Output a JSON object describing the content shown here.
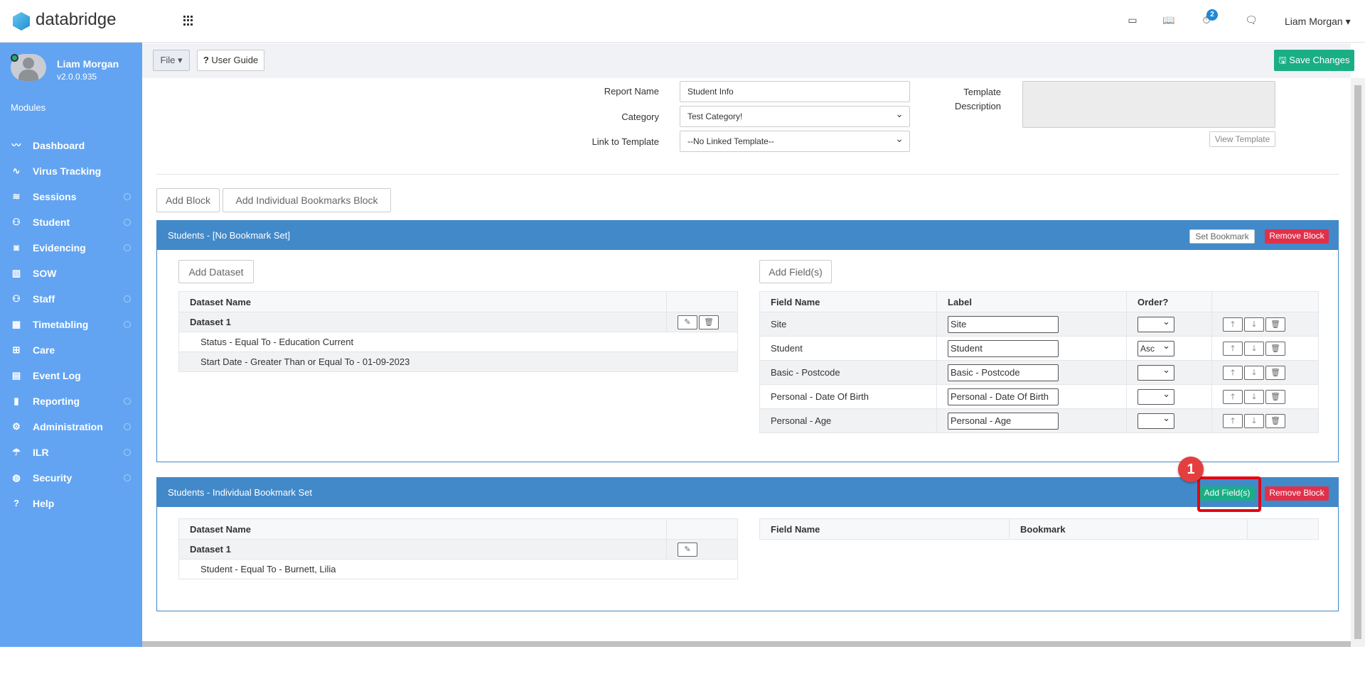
{
  "header": {
    "brand": "databridge",
    "notification_count": "2",
    "user": "Liam Morgan"
  },
  "sidebar": {
    "user_name": "Liam Morgan",
    "version": "v2.0.0.935",
    "modules_label": "Modules",
    "items": [
      {
        "label": "Dashboard",
        "icon": "chart-line-icon"
      },
      {
        "label": "Virus Tracking",
        "icon": "pulse-icon"
      },
      {
        "label": "Sessions",
        "icon": "layers-icon"
      },
      {
        "label": "Student",
        "icon": "users-icon"
      },
      {
        "label": "Evidencing",
        "icon": "camera-icon"
      },
      {
        "label": "SOW",
        "icon": "book-icon"
      },
      {
        "label": "Staff",
        "icon": "users-icon"
      },
      {
        "label": "Timetabling",
        "icon": "calendar-icon"
      },
      {
        "label": "Care",
        "icon": "care-icon"
      },
      {
        "label": "Event Log",
        "icon": "clipboard-icon"
      },
      {
        "label": "Reporting",
        "icon": "bar-chart-icon"
      },
      {
        "label": "Administration",
        "icon": "gear-icon"
      },
      {
        "label": "ILR",
        "icon": "umbrella-icon"
      },
      {
        "label": "Security",
        "icon": "globe-icon"
      },
      {
        "label": "Help",
        "icon": "help-icon"
      }
    ]
  },
  "toolbar": {
    "file": "File ▾",
    "user_guide": "User Guide",
    "save": "Save Changes"
  },
  "form": {
    "report_name_label": "Report Name",
    "report_name": "Student Info",
    "category_label": "Category",
    "category": "Test Category!",
    "link_label": "Link to Template",
    "link": "--No Linked Template--",
    "template_desc_label_1": "Template",
    "template_desc_label_2": "Description",
    "view_template": "View Template"
  },
  "actions": {
    "add_block": "Add Block",
    "add_bookmarks_block": "Add Individual Bookmarks Block"
  },
  "block1": {
    "title": "Students - [No Bookmark Set]",
    "set_bookmark": "Set Bookmark",
    "remove": "Remove Block",
    "add_dataset": "Add Dataset",
    "add_fields": "Add Field(s)",
    "dataset_header": "Dataset Name",
    "dataset_name": "Dataset 1",
    "filters": [
      "Status - Equal To - Education Current",
      "Start Date - Greater Than or Equal To - 01-09-2023"
    ],
    "field_headers": [
      "Field Name",
      "Label",
      "Order?"
    ],
    "fields": [
      {
        "name": "Site",
        "label": "Site",
        "order": ""
      },
      {
        "name": "Student",
        "label": "Student",
        "order": "Asc"
      },
      {
        "name": "Basic - Postcode",
        "label": "Basic - Postcode",
        "order": ""
      },
      {
        "name": "Personal - Date Of Birth",
        "label": "Personal - Date Of Birth",
        "order": ""
      },
      {
        "name": "Personal - Age",
        "label": "Personal - Age",
        "order": ""
      }
    ]
  },
  "block2": {
    "title": "Students - Individual Bookmark Set",
    "add_fields": "Add Field(s)",
    "remove": "Remove Block",
    "dataset_header": "Dataset Name",
    "dataset_name": "Dataset 1",
    "filters": [
      "Student - Equal To - Burnett, Lilia"
    ],
    "field_headers": [
      "Field Name",
      "Bookmark"
    ]
  },
  "annotation": {
    "step": "1"
  }
}
